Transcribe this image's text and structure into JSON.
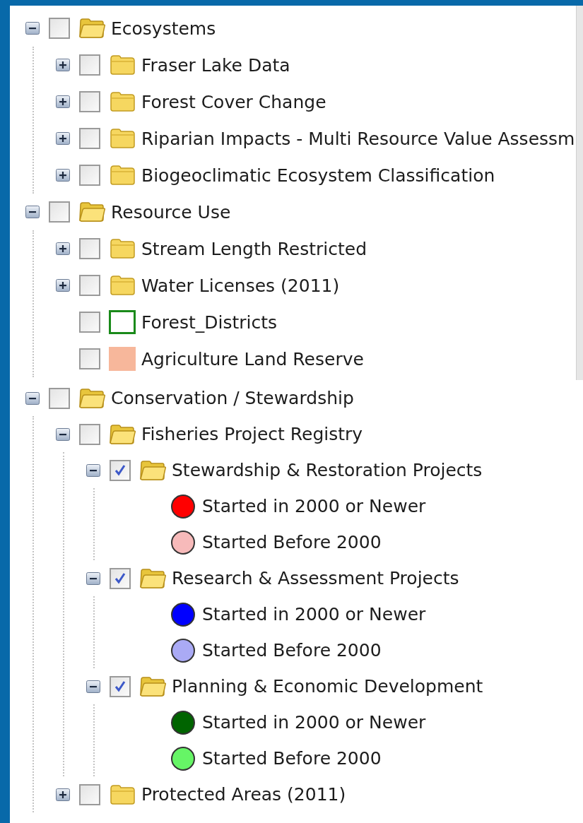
{
  "panels": [
    {
      "nodes": [
        {
          "kind": "folder",
          "label": "Ecosystems",
          "expanded": true,
          "checked": false,
          "children": [
            {
              "kind": "folder",
              "label": "Fraser Lake Data",
              "expanded": false,
              "checked": false
            },
            {
              "kind": "folder",
              "label": "Forest Cover Change",
              "expanded": false,
              "checked": false
            },
            {
              "kind": "folder",
              "label": "Riparian Impacts - Multi Resource Value Assessm",
              "expanded": false,
              "checked": false
            },
            {
              "kind": "folder",
              "label": "Biogeoclimatic Ecosystem Classification",
              "expanded": false,
              "checked": false
            }
          ]
        },
        {
          "kind": "folder",
          "label": "Resource Use",
          "expanded": true,
          "checked": false,
          "children": [
            {
              "kind": "folder",
              "label": "Stream Length Restricted",
              "expanded": false,
              "checked": false
            },
            {
              "kind": "folder",
              "label": "Water Licenses (2011)",
              "expanded": false,
              "checked": false
            },
            {
              "kind": "outline",
              "label": "Forest_Districts",
              "checked": false,
              "color": "#1a8a1a"
            },
            {
              "kind": "swatch",
              "label": "Agriculture Land Reserve",
              "checked": false,
              "color": "#f7b79b"
            }
          ]
        }
      ]
    },
    {
      "nodes": [
        {
          "kind": "folder",
          "label": "Conservation / Stewardship",
          "expanded": true,
          "checked": false,
          "children": [
            {
              "kind": "folder",
              "label": "Fisheries Project Registry",
              "expanded": true,
              "checked": false,
              "children": [
                {
                  "kind": "folder",
                  "label": "Stewardship & Restoration Projects",
                  "expanded": true,
                  "checked": true,
                  "children": [
                    {
                      "kind": "legend",
                      "label": "Started in 2000 or Newer",
                      "color": "#ff0000"
                    },
                    {
                      "kind": "legend",
                      "label": "Started Before 2000",
                      "color": "#f7baba"
                    }
                  ]
                },
                {
                  "kind": "folder",
                  "label": "Research & Assessment Projects",
                  "expanded": true,
                  "checked": true,
                  "children": [
                    {
                      "kind": "legend",
                      "label": "Started in 2000 or Newer",
                      "color": "#0000ff"
                    },
                    {
                      "kind": "legend",
                      "label": "Started Before 2000",
                      "color": "#aaaaf5"
                    }
                  ]
                },
                {
                  "kind": "folder",
                  "label": "Planning & Economic Development",
                  "expanded": true,
                  "checked": true,
                  "children": [
                    {
                      "kind": "legend",
                      "label": "Started in 2000 or Newer",
                      "color": "#006400"
                    },
                    {
                      "kind": "legend",
                      "label": "Started Before 2000",
                      "color": "#66f566"
                    }
                  ]
                }
              ]
            },
            {
              "kind": "folder",
              "label": "Protected Areas (2011)",
              "expanded": false,
              "checked": false
            }
          ]
        }
      ]
    }
  ]
}
